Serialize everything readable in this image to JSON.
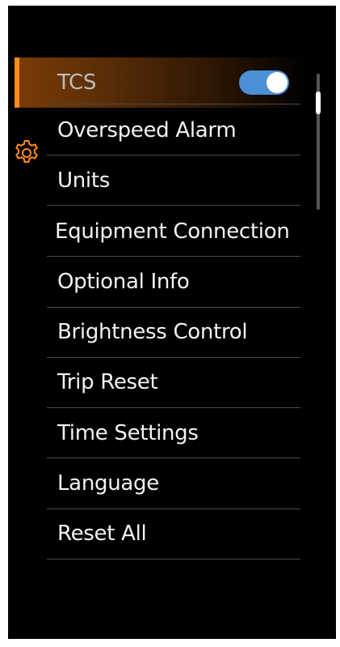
{
  "menu": {
    "items": [
      {
        "label": "TCS"
      },
      {
        "label": "Overspeed Alarm"
      },
      {
        "label": "Units"
      },
      {
        "label": "Equipment Connection"
      },
      {
        "label": "Optional Info"
      },
      {
        "label": "Brightness Control"
      },
      {
        "label": "Trip Reset"
      },
      {
        "label": "Time Settings"
      },
      {
        "label": "Language"
      },
      {
        "label": "Reset All"
      }
    ],
    "selected_index": 0,
    "tcs_toggle_on": true
  },
  "icons": {
    "section_icon": "gear-icon"
  },
  "colors": {
    "background": "#000000",
    "accent": "#ff8c1a",
    "toggle_on": "#4a90d6",
    "text": "#f2f2f2"
  }
}
